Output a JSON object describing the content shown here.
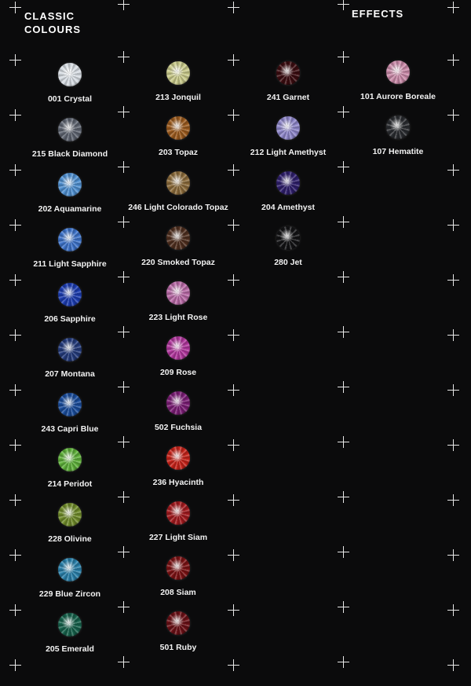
{
  "headings": {
    "classic": "CLASSIC\nCOLOURS",
    "effects": "EFFECTS"
  },
  "classic_column_1": [
    {
      "label": "001 Crystal",
      "color": "#d7dde3"
    },
    {
      "label": "215 Black Diamond",
      "color": "#5e6470"
    },
    {
      "label": "202 Aquamarine",
      "color": "#4f8fcf"
    },
    {
      "label": "211 Light Sapphire",
      "color": "#3d72c8"
    },
    {
      "label": "206 Sapphire",
      "color": "#1c3cae"
    },
    {
      "label": "207 Montana",
      "color": "#233a7a"
    },
    {
      "label": "243 Capri Blue",
      "color": "#1a4c9a"
    },
    {
      "label": "214 Peridot",
      "color": "#5eaf3a"
    },
    {
      "label": "228 Olivine",
      "color": "#6f8a2a"
    },
    {
      "label": "229 Blue Zircon",
      "color": "#2a7fa8"
    },
    {
      "label": "205 Emerald",
      "color": "#16604a"
    }
  ],
  "classic_column_2": [
    {
      "label": "213 Jonquil",
      "color": "#c8c98a"
    },
    {
      "label": "203 Topaz",
      "color": "#9a5a1e"
    },
    {
      "label": "246 Light Colorado Topaz",
      "color": "#8a6a3a"
    },
    {
      "label": "220 Smoked Topaz",
      "color": "#4e2e1e"
    },
    {
      "label": "223 Light Rose",
      "color": "#b86aa6"
    },
    {
      "label": "209 Rose",
      "color": "#b0379c"
    },
    {
      "label": "502 Fuchsia",
      "color": "#7a1d74"
    },
    {
      "label": "236 Hyacinth",
      "color": "#c4231a"
    },
    {
      "label": "227 Light Siam",
      "color": "#a11a1e"
    },
    {
      "label": "208 Siam",
      "color": "#7a1214"
    },
    {
      "label": "501 Ruby",
      "color": "#6a1016"
    }
  ],
  "classic_column_3": [
    {
      "label": "241 Garnet",
      "color": "#3a0c10"
    },
    {
      "label": "212 Light Amethyst",
      "color": "#8e86c8"
    },
    {
      "label": "204 Amethyst",
      "color": "#2e1e6a"
    },
    {
      "label": "280 Jet",
      "color": "#121214"
    }
  ],
  "effects_column": [
    {
      "label": "101 Aurore Boreale",
      "color": "#c98aa8"
    },
    {
      "label": "107 Hematite",
      "color": "#2a2c30"
    }
  ]
}
